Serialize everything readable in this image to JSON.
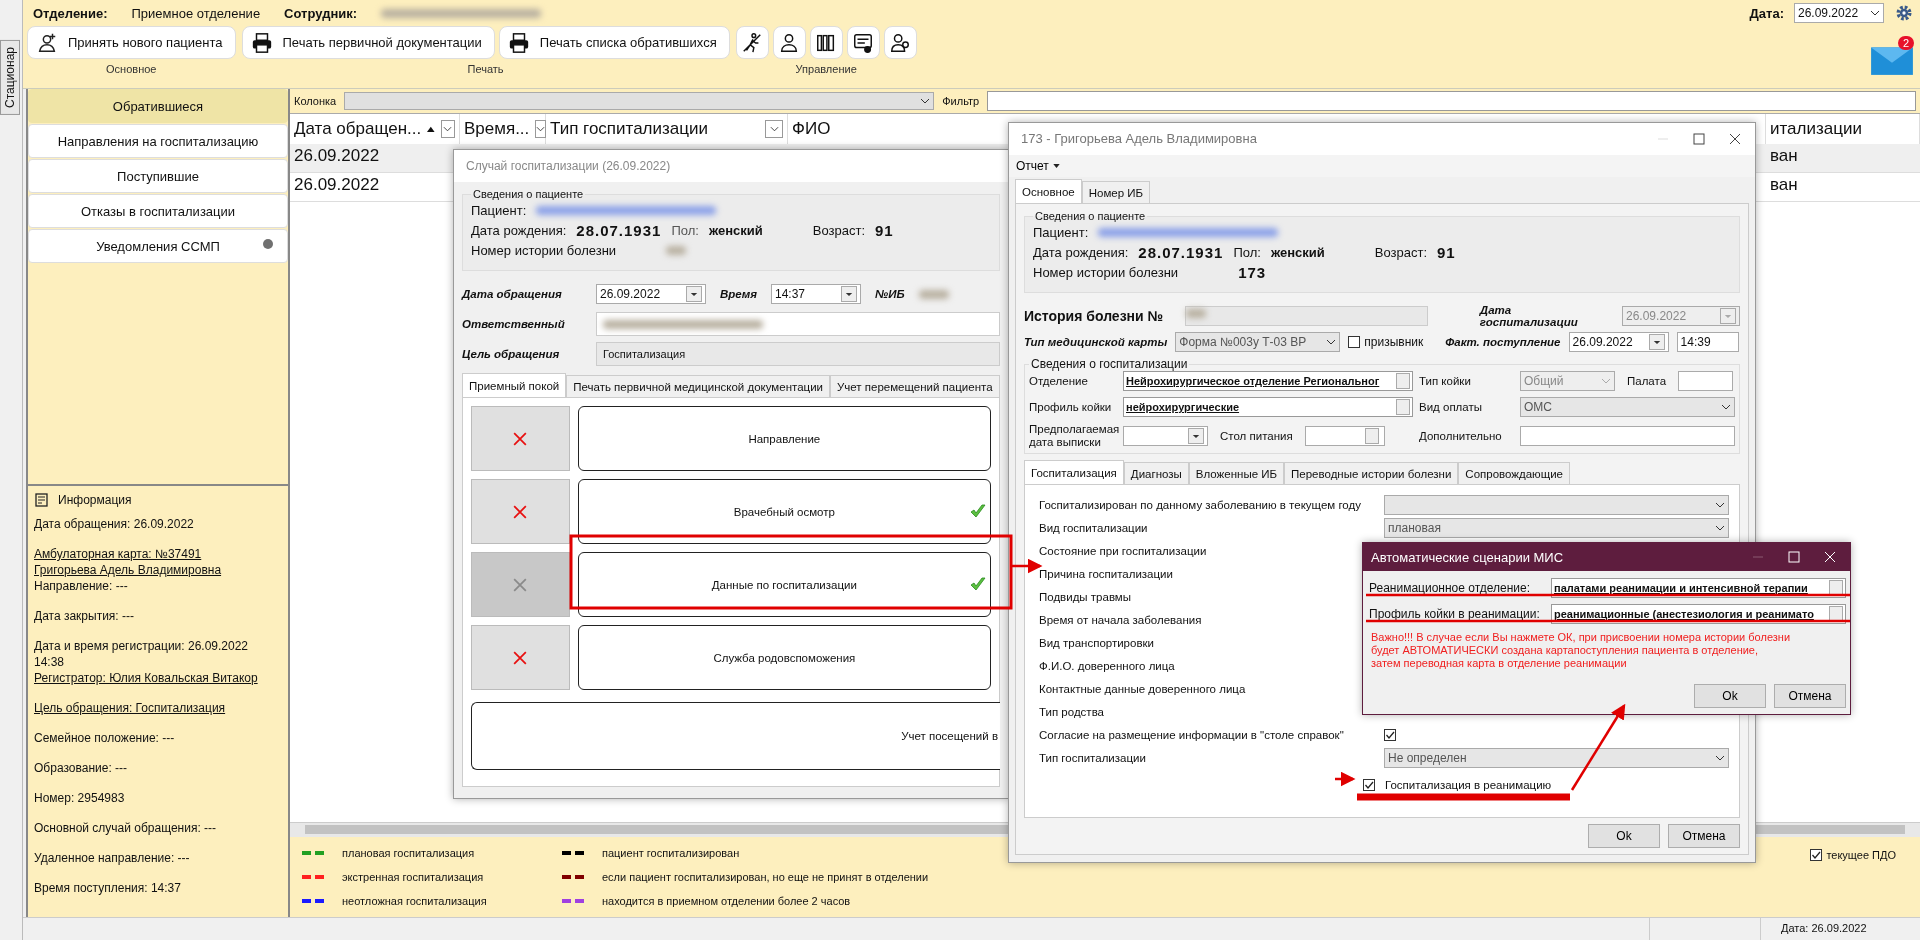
{
  "side_tab": "Стационар",
  "header": {
    "department_label": "Отделение:",
    "department": "Приемное отделение",
    "employee_label": "Сотрудник:",
    "date_label": "Дата:",
    "date": "26.09.2022",
    "mail_badge": "2"
  },
  "toolbar": [
    {
      "label": "Основное",
      "buttons": [
        {
          "kind": "text",
          "label": "Принять нового пациента"
        }
      ]
    },
    {
      "label": "Печать",
      "buttons": [
        {
          "kind": "text",
          "label": "Печать первичной документации"
        },
        {
          "kind": "text",
          "label": "Печать списка обратившихся"
        }
      ]
    },
    {
      "label": "Управление",
      "buttons": [
        {
          "kind": "icon"
        },
        {
          "kind": "icon"
        },
        {
          "kind": "icon"
        },
        {
          "kind": "icon"
        },
        {
          "kind": "icon"
        }
      ]
    }
  ],
  "sidebar": {
    "items": [
      {
        "label": "Обратившиеся",
        "selected": true,
        "indicator": false
      },
      {
        "label": "Направления на госпитализацию",
        "selected": false,
        "indicator": false
      },
      {
        "label": "Поступившие",
        "selected": false,
        "indicator": false
      },
      {
        "label": "Отказы в госпитализации",
        "selected": false,
        "indicator": false
      },
      {
        "label": "Уведомления ССМП",
        "selected": false,
        "indicator": true
      }
    ]
  },
  "info": {
    "title": "Информация",
    "paragraphs": [
      {
        "lines": [
          {
            "text": "Дата обращения: 26.09.2022",
            "link": false
          }
        ]
      },
      {
        "lines": [
          {
            "text": "Амбулаторная карта: №37491",
            "link": true
          },
          {
            "text": "Григорьева Адель Владимировна",
            "link": true
          },
          {
            "text": "Направление: ---",
            "link": false
          }
        ]
      },
      {
        "lines": [
          {
            "text": "Дата закрытия: ---",
            "link": false
          }
        ]
      },
      {
        "lines": [
          {
            "text": "Дата и время регистрации: 26.09.2022",
            "link": false
          },
          {
            "text": "14:38",
            "link": false
          },
          {
            "text": "Регистратор: Юлия Ковальская Витакор",
            "link": true
          }
        ]
      },
      {
        "lines": [
          {
            "text": "Цель обращения: Госпитализация",
            "link": true
          }
        ]
      },
      {
        "lines": [
          {
            "text": "Семейное положение: ---",
            "link": false
          }
        ]
      },
      {
        "lines": [
          {
            "text": "Образование: ---",
            "link": false
          }
        ]
      },
      {
        "lines": [
          {
            "text": "Номер: 2954983",
            "link": false
          }
        ]
      },
      {
        "lines": [
          {
            "text": "Основной случай обращения: ---",
            "link": false
          }
        ]
      },
      {
        "lines": [
          {
            "text": "Удаленное направление: ---",
            "link": false
          }
        ]
      },
      {
        "lines": [
          {
            "text": "Время поступления: 14:37",
            "link": false
          }
        ]
      }
    ]
  },
  "filter": {
    "column_label": "Колонка",
    "filter_label": "Фильтр"
  },
  "table": {
    "columns": [
      {
        "label": "Дата  обращен...",
        "sorted": true,
        "filter_button": true
      },
      {
        "label": "Время...",
        "sorted": false,
        "filter_button": true
      },
      {
        "label": "Тип госпитализации",
        "sorted": false,
        "filter_button": true
      },
      {
        "label": "ФИО",
        "sorted": false,
        "filter_button": false
      },
      {
        "label": "итализации",
        "sorted": false,
        "filter_button": false
      }
    ],
    "rows": [
      {
        "selected": true,
        "date": "26.09.2022",
        "column_5": "ван"
      },
      {
        "selected": false,
        "date": "26.09.2022",
        "column_5": "ван"
      }
    ]
  },
  "legend": [
    {
      "color": "#22a022",
      "label": "плановая госпитализация"
    },
    {
      "color": "#ff2020",
      "label": "экстренная госпитализация"
    },
    {
      "color": "#1a1aff",
      "label": "неотложная госпитализация"
    },
    {
      "color": "#000000",
      "label": "пациент госпитализирован"
    },
    {
      "color": "#800000",
      "label": "если пациент госпитализирован, но еще не принят в  отделении"
    },
    {
      "color": "#a040e0",
      "label": "находится в приемном отделении более 2 часов"
    }
  ],
  "current_pdo": {
    "label": "текущее ПДО",
    "checked": true
  },
  "status_bar": {
    "date": "Дата: 26.09.2022"
  },
  "case_window": {
    "title": "Случай госпитализации (26.09.2022)",
    "patient": {
      "group_title": "Сведения о пациенте",
      "patient_label": "Пациент:",
      "birth_label": "Дата рождения:",
      "birth_date": "28.07.1931",
      "sex_label": "Пол:",
      "sex": "женский",
      "age_label": "Возраст:",
      "age": "91",
      "history_label": "Номер истории болезни"
    },
    "date_label": "Дата обращения",
    "date": "26.09.2022",
    "time_label": "Время",
    "time": "14:37",
    "ib_label": "№ИБ",
    "responsible_label": "Ответственный",
    "goal_label": "Цель обращения",
    "goal": "Госпитализация",
    "tabs": [
      {
        "label": "Приемный покой",
        "selected": true
      },
      {
        "label": "Печать первичной медицинской документации",
        "selected": false
      },
      {
        "label": "Учет перемещений пациента",
        "selected": false
      }
    ],
    "steps": [
      {
        "label": "Направление",
        "done": false,
        "disabled": false
      },
      {
        "label": "Врачебный осмотр",
        "done": true,
        "disabled": false
      },
      {
        "label": "Данные по госпитализации",
        "done": true,
        "disabled": true
      },
      {
        "label": "Служба родовспоможения",
        "done": false,
        "disabled": false
      }
    ],
    "wide_step": "Учет посещений в"
  },
  "history_window": {
    "title": "173 - Григорьева Адель Владимировна",
    "menu": "Отчет",
    "tabs": [
      {
        "label": "Основное",
        "selected": true
      },
      {
        "label": "Номер ИБ",
        "selected": false
      }
    ],
    "patient": {
      "group_title": "Сведения о пациенте",
      "patient_label": "Пациент:",
      "birth_label": "Дата рождения:",
      "birth_date": "28.07.1931",
      "sex_label": "Пол:",
      "sex": "женский",
      "age_label": "Возраст:",
      "age": "91",
      "history_label": "Номер истории болезни",
      "history_number": "173"
    },
    "history_label": "История болезни №",
    "hosp_date_label": "Дата госпитализации",
    "hosp_date": "26.09.2022",
    "card_type_label": "Тип медицинской карты",
    "card_type": "Форма №003у Т-03 ВР",
    "conscript": {
      "label": "призывник",
      "checked": false
    },
    "arrival_label": "Факт. поступление",
    "arrival_date": "26.09.2022",
    "arrival_time": "14:39",
    "hosp_group": {
      "title": "Сведения о госпитализации",
      "department_label": "Отделение",
      "department": "Нейрохирургическое отделение Региональног",
      "bed_type_label": "Тип койки",
      "bed_type": "Общий",
      "ward_label": "Палата",
      "bed_profile_label": "Профиль койки",
      "bed_profile": "нейрохирургические",
      "payment_label": "Вид оплаты",
      "payment": "ОМС",
      "discharge_label": "Предполагаемая дата выписки",
      "diet_label": "Стол питания",
      "extra_label": "Дополнительно"
    },
    "inner_tabs": [
      {
        "label": "Госпитализация",
        "selected": true
      },
      {
        "label": "Диагнозы",
        "selected": false
      },
      {
        "label": "Вложенные ИБ",
        "selected": false
      },
      {
        "label": "Переводные истории болезни",
        "selected": false
      },
      {
        "label": "Сопровождающие",
        "selected": false
      }
    ],
    "fields": [
      {
        "kind": "select",
        "label": "Госпитализирован по данному заболеванию в текущем году"
      },
      {
        "kind": "select",
        "label": "Вид госпитализации",
        "value": "плановая"
      },
      {
        "kind": "label",
        "label": "Состояние при госпитализации"
      },
      {
        "kind": "label",
        "label": "Причина госпитализации"
      },
      {
        "kind": "label",
        "label": "Подвиды травмы"
      },
      {
        "kind": "label",
        "label": "Время от начала заболевания"
      },
      {
        "kind": "label",
        "label": "Вид транспортировки"
      },
      {
        "kind": "label",
        "label": "Ф.И.О. доверенного лица"
      },
      {
        "kind": "label",
        "label": "Контактные данные доверенного лица"
      },
      {
        "kind": "label",
        "label": "Тип родства"
      },
      {
        "kind": "checkbox",
        "label": "Согласие на размещение информации в \"столе справок\"",
        "checked": true
      },
      {
        "kind": "select",
        "label": "Тип госпитализации",
        "value": "Не определен"
      }
    ],
    "icu": {
      "label": "Госпитализация в реанимацию",
      "checked": true
    },
    "buttons": [
      "Ok",
      "Отмена"
    ]
  },
  "scenario_window": {
    "title": "Автоматические сценарии МИС",
    "fields": [
      {
        "label": "Реанимационное отделение:",
        "value": "палатами реанимации и интенсивной терапии"
      },
      {
        "label": "Профиль койки в реанимации:",
        "value": "реанимационные (анестезиология и реанимато"
      }
    ],
    "warning": "Важно!!! В случае если Вы нажмете ОК, при присвоении номера истории болезни\nбудет АВТОМАТИЧЕСКИ создана картапоступления пациента в отделение,\nзатем переводная карта в отделение реанимации",
    "buttons": [
      "Ok",
      "Отмена"
    ]
  }
}
